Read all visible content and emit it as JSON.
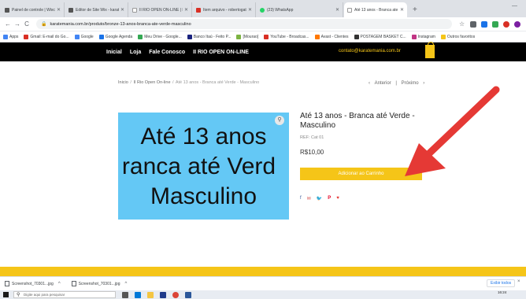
{
  "browser": {
    "tabs": [
      {
        "label": "Painel de controle | Wixcom",
        "favicon_color": "#555555"
      },
      {
        "label": "Editor de Site Wix - karatem",
        "favicon_color": "#555555"
      },
      {
        "label": "II RIO OPEN ON-LINE | Karat",
        "favicon_color": "#ffffff"
      },
      {
        "label": "Item arquivo - robertogate",
        "favicon_color": "#d93025"
      },
      {
        "label": "(23) WhatsApp",
        "favicon_color": "#25d366"
      },
      {
        "label": "Até 13 anos - Branca ate Ver",
        "favicon_color": "#ffffff"
      }
    ],
    "new_tab": "+",
    "window_minimize": "—",
    "url": "karatemania.com.br/produto/bronze-13-anos-branca-ate-verde-masculino",
    "back": "←",
    "forward": "→",
    "reload": "C",
    "lock": "🔒",
    "bookmarks": [
      {
        "label": "Apps",
        "color": "#4285f4"
      },
      {
        "label": "Gmail: E-mail do Go...",
        "color": "#d93025"
      },
      {
        "label": "Google",
        "color": "#4285f4"
      },
      {
        "label": "Google Agenda",
        "color": "#1a73e8"
      },
      {
        "label": "Meu Drive - Google...",
        "color": "#34a853"
      },
      {
        "label": "Banco Itaú - Feito P...",
        "color": "#1a237e"
      },
      {
        "label": "[Mourao]",
        "color": "#7cb342"
      },
      {
        "label": "YouTube - Broadcas...",
        "color": "#d93025"
      },
      {
        "label": "Avast - Clientes",
        "color": "#ff7800"
      },
      {
        "label": "POSTAGEM BASKET C...",
        "color": "#333333"
      },
      {
        "label": "Instagram",
        "color": "#c13584"
      },
      {
        "label": "Outros favoritos",
        "color": "#f5c518"
      }
    ]
  },
  "site": {
    "nav": [
      "Inicial",
      "Loja",
      "Fale Conosco",
      "II RIO OPEN ON-LINE"
    ],
    "contact_email": "contato@karatemania.com.br",
    "accent": "#f5c518"
  },
  "breadcrumb": {
    "home": "Inicio",
    "sep": "/",
    "category": "II Rio Open On-line",
    "current": "Até 13 anos - Branca até Verde - Masculino"
  },
  "pager": {
    "prev": "Anterior",
    "divider": "|",
    "next": "Próximo"
  },
  "product": {
    "image_lines": [
      "Até 13 anos",
      "ranca até Verd",
      "Masculino"
    ],
    "image_bg": "#64c8f5",
    "title": "Até 13 anos - Branca até Verde - Masculino",
    "ref": "REF: Cat 01",
    "price": "R$10,00",
    "add_to_cart": "Adicionar ao Carrinho",
    "share_icons": [
      "f",
      "✉",
      "🐦",
      "P",
      "♥"
    ]
  },
  "downloads": {
    "items": [
      "Screenshot_70301...jpg",
      "Screenshot_70301...jpg"
    ],
    "show_all": "Exibir todos",
    "close": "×"
  },
  "taskbar": {
    "search_placeholder": "Digite aqui para pesquisar",
    "time": "16:24"
  }
}
